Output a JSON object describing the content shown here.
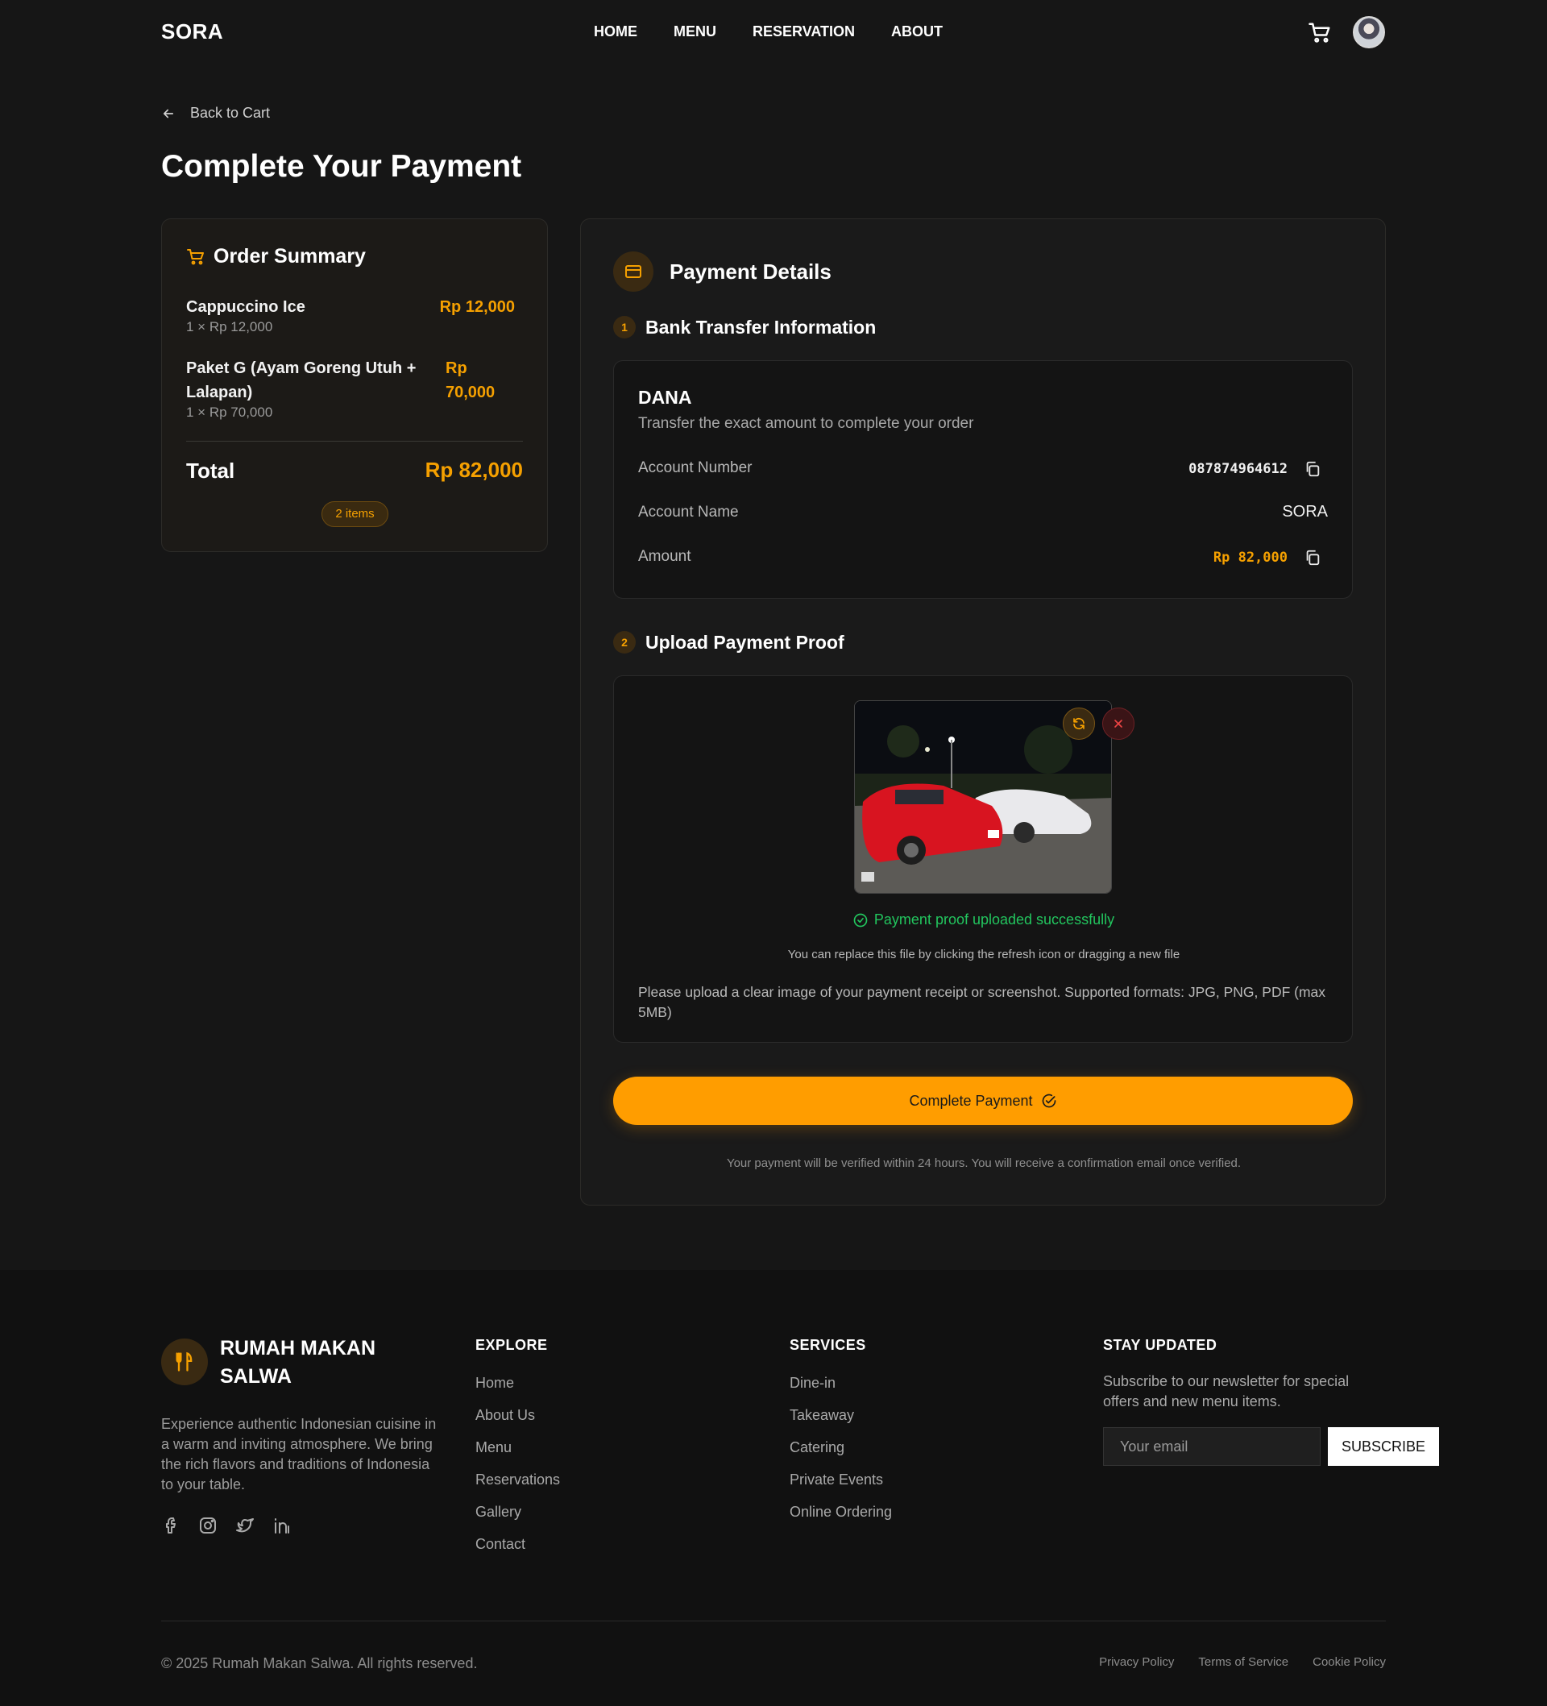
{
  "nav": {
    "logo": "SORA",
    "links": [
      "HOME",
      "MENU",
      "RESERVATION",
      "ABOUT"
    ]
  },
  "page": {
    "back_label": "Back to Cart",
    "title": "Complete Your Payment"
  },
  "order_summary": {
    "title": "Order Summary",
    "items": [
      {
        "name": "Cappuccino Ice",
        "detail": "1 × Rp 12,000",
        "price": "Rp 12,000"
      },
      {
        "name": "Paket G (Ayam Goreng Utuh + Lalapan)",
        "detail": "1 × Rp 70,000",
        "price": "Rp 70,000"
      }
    ],
    "total_label": "Total",
    "total_value": "Rp 82,000",
    "items_badge": "2 items"
  },
  "payment": {
    "title": "Payment Details",
    "step1": {
      "num": "1",
      "title": "Bank Transfer Information"
    },
    "bank": {
      "name": "DANA",
      "description": "Transfer the exact amount to complete your order",
      "account_number_label": "Account Number",
      "account_number": "087874964612",
      "account_name_label": "Account Name",
      "account_name": "SORA",
      "amount_label": "Amount",
      "amount": "Rp 82,000"
    },
    "step2": {
      "num": "2",
      "title": "Upload Payment Proof"
    },
    "upload": {
      "success": "Payment proof uploaded successfully",
      "replace_note": "You can replace this file by clicking the refresh icon or dragging a new file",
      "formats_note": "Please upload a clear image of your payment receipt or screenshot. Supported formats: JPG, PNG, PDF (max 5MB)"
    },
    "complete_button": "Complete Payment",
    "verify_note": "Your payment will be verified within 24 hours. You will receive a confirmation email once verified."
  },
  "footer": {
    "brand": "RUMAH MAKAN SALWA",
    "about": "Experience authentic Indonesian cuisine in a warm and inviting atmosphere. We bring the rich flavors and traditions of Indonesia to your table.",
    "explore": {
      "heading": "EXPLORE",
      "links": [
        "Home",
        "About Us",
        "Menu",
        "Reservations",
        "Gallery",
        "Contact"
      ]
    },
    "services": {
      "heading": "SERVICES",
      "links": [
        "Dine-in",
        "Takeaway",
        "Catering",
        "Private Events",
        "Online Ordering"
      ]
    },
    "newsletter": {
      "heading": "STAY UPDATED",
      "text": "Subscribe to our newsletter for special offers and new menu items.",
      "placeholder": "Your email",
      "button": "SUBSCRIBE"
    },
    "copyright": "© 2025 Rumah Makan Salwa. All rights reserved.",
    "legal": [
      "Privacy Policy",
      "Terms of Service",
      "Cookie Policy"
    ]
  },
  "colors": {
    "accent": "#ff9d00",
    "success": "#22c55e",
    "danger": "#ef4444",
    "background": "#161616"
  }
}
